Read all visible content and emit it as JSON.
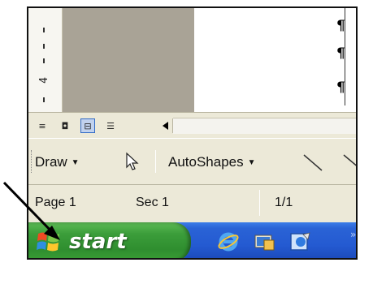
{
  "ruler": {
    "number": "4"
  },
  "document": {
    "marks": [
      "¶",
      "¶",
      "¶"
    ]
  },
  "view_buttons": [
    {
      "name": "normal-view-button",
      "glyph": "≡"
    },
    {
      "name": "web-layout-view-button",
      "glyph": "◘"
    },
    {
      "name": "print-layout-view-button",
      "glyph": "⊟"
    },
    {
      "name": "outline-view-button",
      "glyph": "☰"
    }
  ],
  "drawing_toolbar": {
    "draw_label": "Draw",
    "autoshapes_label": "AutoShapes"
  },
  "status": {
    "page": "Page 1",
    "section": "Sec 1",
    "fraction": "1/1"
  },
  "taskbar": {
    "start_label": "start",
    "quick_launch": [
      "internet-explorer-icon",
      "show-desktop-icon",
      "outlook-express-icon"
    ],
    "chevron": "»"
  },
  "colors": {
    "taskbar_blue": "#245ad1",
    "start_green": "#3b9d3a",
    "toolbar_bg": "#ece9d8"
  }
}
